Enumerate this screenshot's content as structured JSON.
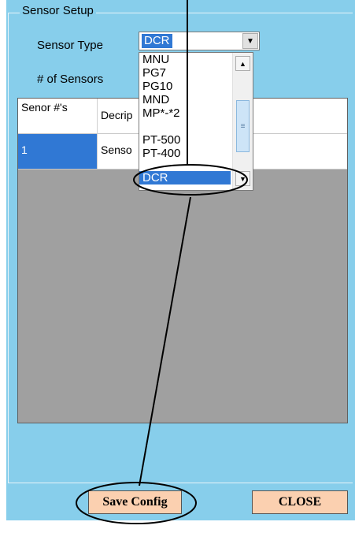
{
  "groupbox": {
    "title": "Sensor Setup"
  },
  "labels": {
    "sensor_type": "Sensor Type",
    "num_sensors": "# of Sensors"
  },
  "sensor_type_combo": {
    "value": "DCR"
  },
  "dropdown": {
    "options": [
      "MNU",
      "PG7",
      "PG10",
      "MND",
      "MP*-*2",
      "PT-500",
      "PT-400",
      "DCR"
    ],
    "selected": "DCR"
  },
  "grid": {
    "columns": [
      "Senor #'s",
      "Decrip"
    ],
    "rows": [
      {
        "number": "1",
        "description": "Senso"
      }
    ]
  },
  "buttons": {
    "save": "Save Config",
    "close": "CLOSE"
  },
  "colors": {
    "window_bg": "#87ceeb",
    "selection": "#3078d4",
    "button_bg": "#fbd0b0",
    "grid_empty": "#a0a0a0"
  },
  "icons": {
    "combo_arrow": "chevron-down-icon",
    "scroll_up": "arrow-up-icon",
    "scroll_down": "arrow-down-icon"
  }
}
